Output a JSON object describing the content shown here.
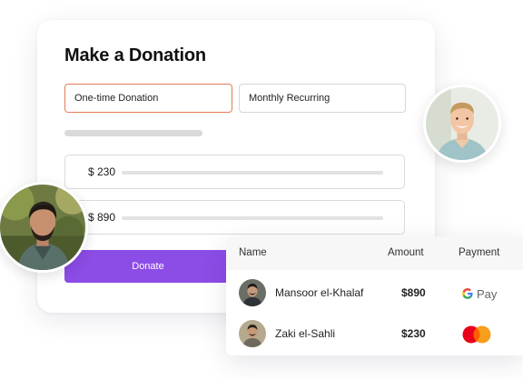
{
  "donation_form": {
    "title": "Make a Donation",
    "tabs": [
      {
        "label": "One-time Donation",
        "selected": true
      },
      {
        "label": "Monthly Recurring",
        "selected": false
      }
    ],
    "amounts": [
      {
        "label": "$ 230"
      },
      {
        "label": "$ 890"
      }
    ],
    "donate_label": "Donate"
  },
  "donors_table": {
    "headers": {
      "name": "Name",
      "amount": "Amount",
      "payment": "Payment"
    },
    "rows": [
      {
        "name": "Mansoor el-Khalaf",
        "amount": "$890",
        "payment_method": "google-pay"
      },
      {
        "name": "Zaki el-Sahli",
        "amount": "$230",
        "payment_method": "mastercard"
      }
    ],
    "gpay_text": "Pay"
  },
  "colors": {
    "accent": "#8c4ce6",
    "selected_tab_border": "#e27d57",
    "mastercard_red": "#eb001b",
    "mastercard_orange": "#f79e1b"
  },
  "icons": [
    "google-pay-icon",
    "mastercard-icon"
  ]
}
